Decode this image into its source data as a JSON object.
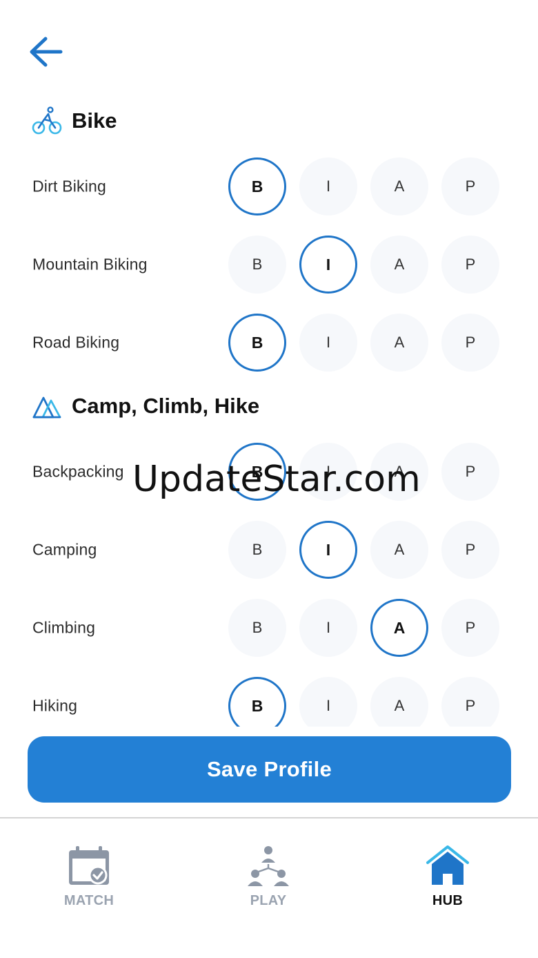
{
  "header": {
    "back_icon": "arrow-left-icon"
  },
  "sections": [
    {
      "title": "Bike",
      "icon": "bicycle-rider-icon",
      "activities": [
        {
          "label": "Dirt Biking",
          "selected": "B"
        },
        {
          "label": "Mountain Biking",
          "selected": "I"
        },
        {
          "label": "Road Biking",
          "selected": "B"
        }
      ]
    },
    {
      "title": "Camp, Climb, Hike",
      "icon": "mountain-icon",
      "activities": [
        {
          "label": "Backpacking",
          "selected": "B"
        },
        {
          "label": "Camping",
          "selected": "I"
        },
        {
          "label": "Climbing",
          "selected": "A"
        },
        {
          "label": "Hiking",
          "selected": "B"
        }
      ]
    }
  ],
  "levels": [
    "B",
    "I",
    "A",
    "P"
  ],
  "save_button": {
    "label": "Save Profile"
  },
  "nav": {
    "items": [
      {
        "label": "MATCH",
        "icon": "calendar-check-icon",
        "active": false
      },
      {
        "label": "PLAY",
        "icon": "group-people-icon",
        "active": false
      },
      {
        "label": "HUB",
        "icon": "home-icon",
        "active": true
      }
    ]
  },
  "watermark": "UpdateStar.com",
  "colors": {
    "accent": "#2380d5",
    "selected_ring": "#1f75c8",
    "inactive_nav": "#9aa3b0",
    "option_bg": "#f6f8fb"
  }
}
